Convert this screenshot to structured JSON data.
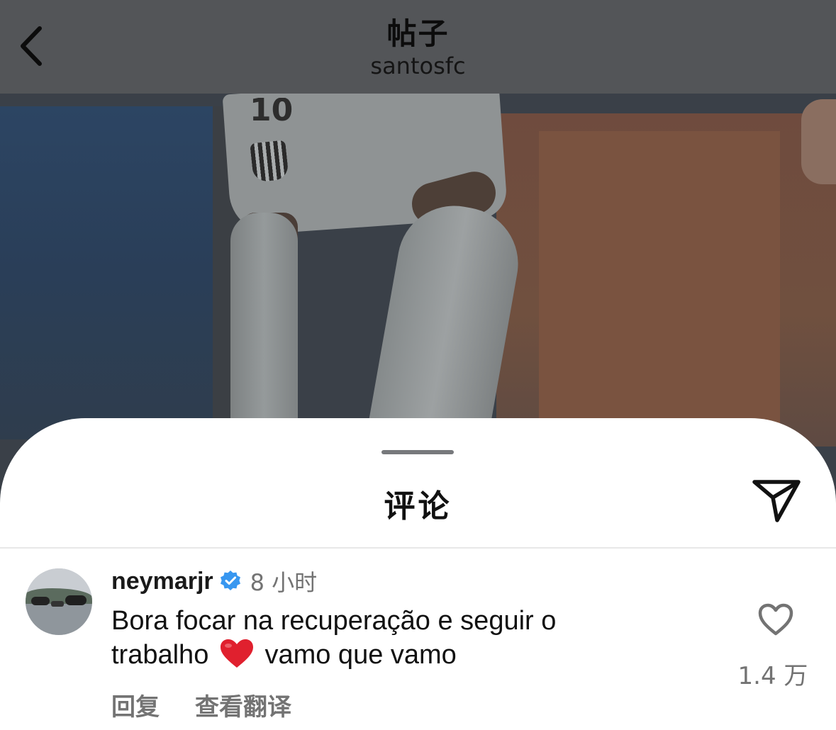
{
  "header": {
    "title": "帖子",
    "subtitle": "santosfc",
    "back_icon": "chevron-left-icon"
  },
  "photo": {
    "jersey_number": "10"
  },
  "sheet": {
    "title": "评论",
    "share_icon": "paper-plane-icon"
  },
  "comment": {
    "username": "neymarjr",
    "verified": true,
    "time": "8 小时",
    "text_part1": "Bora focar na recuperação e seguir o trabalho",
    "emoji": "red-heart",
    "text_part2": "vamo que vamo",
    "reply_label": "回复",
    "translate_label": "查看翻译",
    "like_icon": "heart-outline-icon",
    "like_count": "1.4 万"
  },
  "colors": {
    "header_overlay": "#535558",
    "verified_blue": "#3897f0",
    "secondary_text": "#737373",
    "emoji_red": "#e0202e"
  }
}
